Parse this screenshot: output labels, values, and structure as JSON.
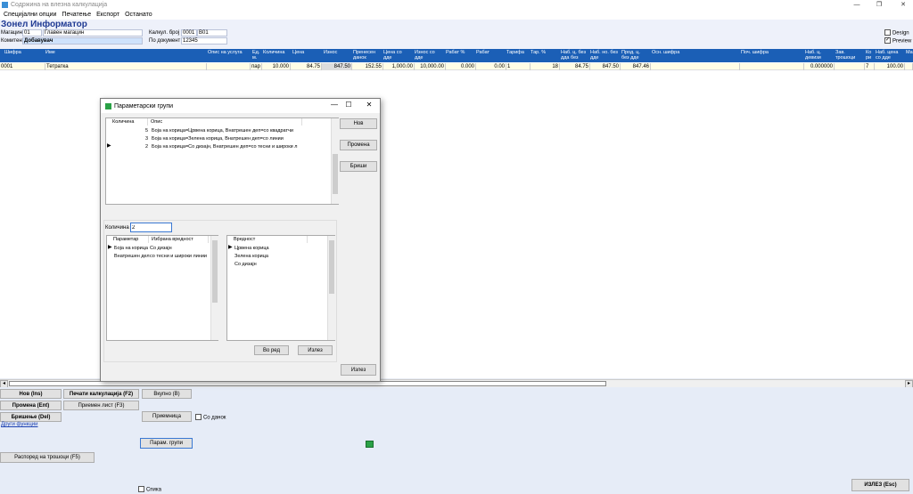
{
  "window": {
    "title": "Содржина на влезна калкулација",
    "min": "—",
    "max": "❐",
    "close": "✕"
  },
  "menu": [
    "Специјални опции",
    "Печатење",
    "Експорт",
    "Останато"
  ],
  "company": "Зонел Информатор",
  "header": {
    "warehouse_label": "Магацин",
    "warehouse_code": "01",
    "warehouse_name": "Главен магацин",
    "calc_label": "Калкул. број",
    "calc_no": "0001",
    "calc_suffix": "В01",
    "partner_label": "Комитент",
    "partner": "Добавувач",
    "doc_label": "По документ",
    "doc_no": "12345",
    "design_label": "Design",
    "preview_label": "Preview"
  },
  "grid": {
    "headers": [
      "Шифра",
      "Име",
      "Опис на услуга",
      "Ед. м.",
      "Количина",
      "Цена",
      "Износ",
      "Пренесен данок",
      "Цена со дде",
      "Износ со дде",
      "Рабат %",
      "Рабат",
      "Тарифа",
      "Тар. %",
      "Наб. ц. без дда без",
      "Наб. но. без дде",
      "Прод. ц. без дде",
      "Осн. шифра",
      "Поч. шифра",
      "Наб. ц. девизи",
      "Зав. трошоци",
      "Ко ри",
      "Наб. цена со дде",
      "Ма"
    ],
    "rows": [
      {
        "cells": [
          "0001",
          "Тетратка",
          "",
          "пар",
          "10.000",
          "84.75",
          "847.50",
          "152.55",
          "1,000.00",
          "10,000.00",
          "0.000",
          "0.00",
          "1",
          "18",
          "84.75",
          "847.50",
          "847.46",
          "",
          "",
          "0.000000",
          "",
          "7",
          "100.00",
          ""
        ]
      }
    ]
  },
  "buttons": {
    "new": "Нов (Ins)",
    "print": "Печати калкулација (F2)",
    "total": "Вкупно (В)",
    "change": "Промена (Ent)",
    "receipt": "Приемен лист (F3)",
    "delete": "Бришење (Del)",
    "primenica": "Приемница",
    "with_tax": "Со данок",
    "other": "Други функции",
    "param": "Парам. групи",
    "distribute": "Распоред на трошоци (F5)",
    "exit": "ИЗЛЕЗ (Esc)",
    "spika": "Спика"
  },
  "dialog": {
    "title": "Параметарски групи",
    "col_qty": "Количина",
    "col_desc": "Опис",
    "rows": [
      {
        "qty": "5",
        "desc": "Боја на корица=Црвена корица, Внатрешен деп=со квадратчи"
      },
      {
        "qty": "3",
        "desc": "Боја на корица=Зелена корица, Внатрешен деп=со линии"
      },
      {
        "qty": "2",
        "desc": "Боја на корица=Со дизајн, Внатрешен деп=со тесни и широки л"
      }
    ],
    "btn_new": "Нов",
    "btn_change": "Промена",
    "btn_delete": "Бриши",
    "qty_label": "Количина",
    "qty_value": "2",
    "param_head": "Параметар",
    "chosen_head": "Избрана вредност",
    "params": [
      {
        "p": "Боја на корица",
        "v": "Со дизајн"
      },
      {
        "p": "Внатрешен дел",
        "v": "со тесни и широки линии"
      }
    ],
    "value_head": "Вредност",
    "values": [
      "Црвена корица",
      "Зелена корица",
      "Со дизајн"
    ],
    "btn_ok": "Во ред",
    "btn_cancel": "Излез",
    "btn_exit": "Излез"
  }
}
